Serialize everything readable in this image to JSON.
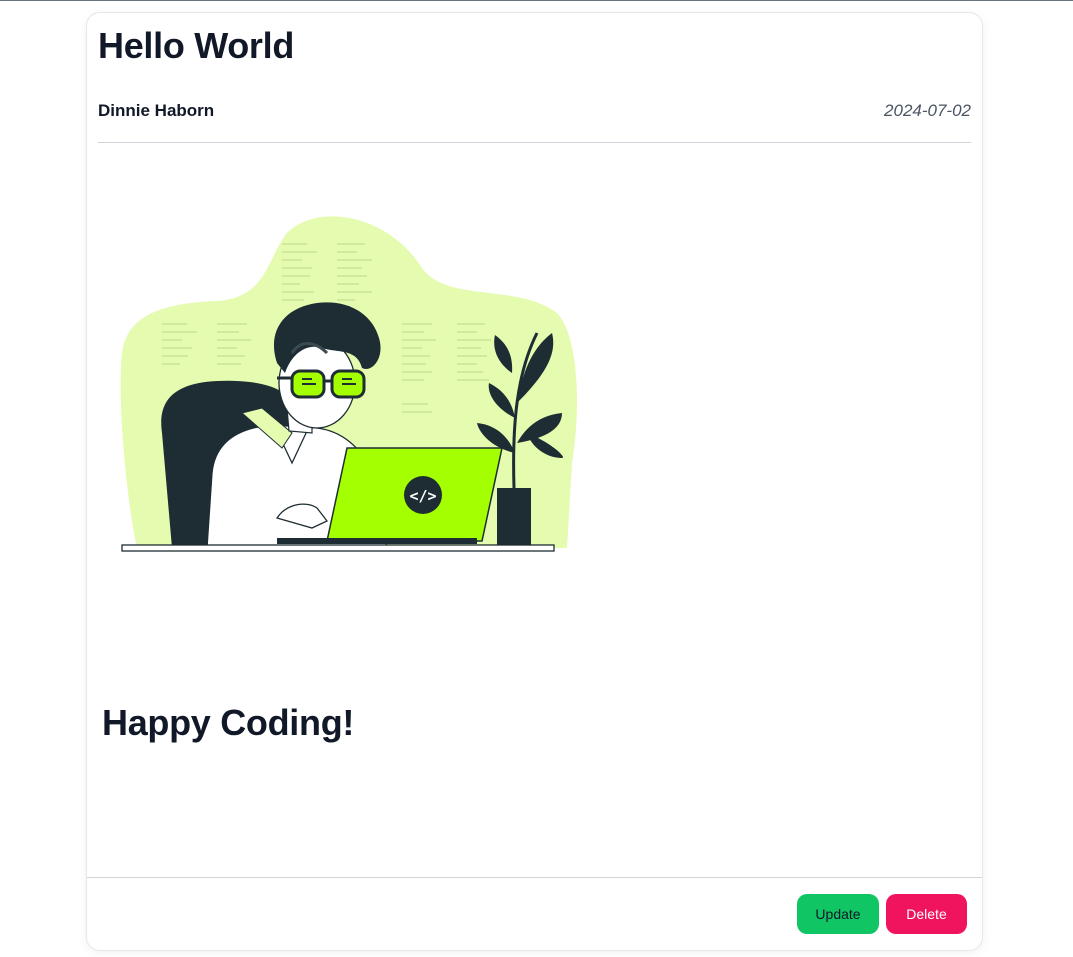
{
  "post": {
    "title": "Hello World",
    "author": "Dinnie Haborn",
    "date": "2024-07-02",
    "image": {
      "icon": "developer-coding-illustration",
      "code_symbol": "</>",
      "colors": {
        "accent": "#a4ff00",
        "blob": "#e4fbb0",
        "dark": "#1e2d33"
      }
    },
    "content_heading": "Happy Coding!"
  },
  "actions": {
    "update_label": "Update",
    "delete_label": "Delete",
    "update_color": "#10c563",
    "delete_color": "#f0145e"
  }
}
